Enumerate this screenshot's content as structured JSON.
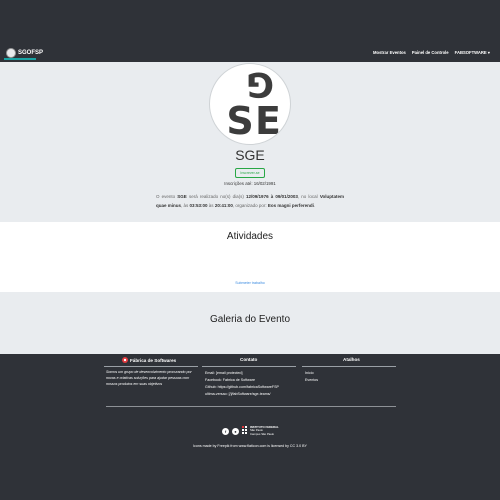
{
  "nav": {
    "brand": "SGOFSP",
    "links": [
      "Mostrar Eventos",
      "Painel de Controle",
      "FABSOFTWARE ▾"
    ]
  },
  "event": {
    "logo_letters": [
      "G",
      "S",
      "E"
    ],
    "title": "SGE",
    "subscribe_label": "Inscrever-se",
    "registration": "Inscrições até: 16/02/1991",
    "desc": {
      "p1": "O evento ",
      "name": "SGE",
      "p2": " será realizado no(s) dia(s) ",
      "dates": "12/09/1976 à 09/01/2003",
      "p3": ", no local ",
      "location": "Voluptatem quae minus",
      "p4": ", às ",
      "start_time": "03:53:00",
      "p5": " às ",
      "end_time": "20:41:00",
      "p6": ", organizado por: ",
      "org": "Eos magni perferendi",
      "p7": "."
    }
  },
  "activities": {
    "title": "Atividades",
    "submit_link": "Submeter trabalho"
  },
  "gallery": {
    "title": "Galeria do Evento"
  },
  "footer": {
    "col1": {
      "title": "Fábrica de Softwares",
      "text": "Somos um grupo de desenvolvimento procurando por novas e criativas soluções para ajudar pessoas com nossos produtos em suas objetivos"
    },
    "col2": {
      "title": "Contato",
      "lines": [
        "Email: [email protected]",
        "Facebook: Fabrica de Software",
        "Github: https://github.com/fabricaSoftwareFSP",
        "ultima-versao: [/]/fabSoftware/sge-teams/"
      ]
    },
    "col3": {
      "title": "Atalhos",
      "links": [
        "Início",
        "Eventos"
      ]
    },
    "institute": [
      "INSTITUTO FEDERAL",
      "São Paulo",
      "Campus São Paulo"
    ],
    "credit": "Icons made by Freepik from www.flaticon.com is licensed by CC 3.0 BY"
  }
}
